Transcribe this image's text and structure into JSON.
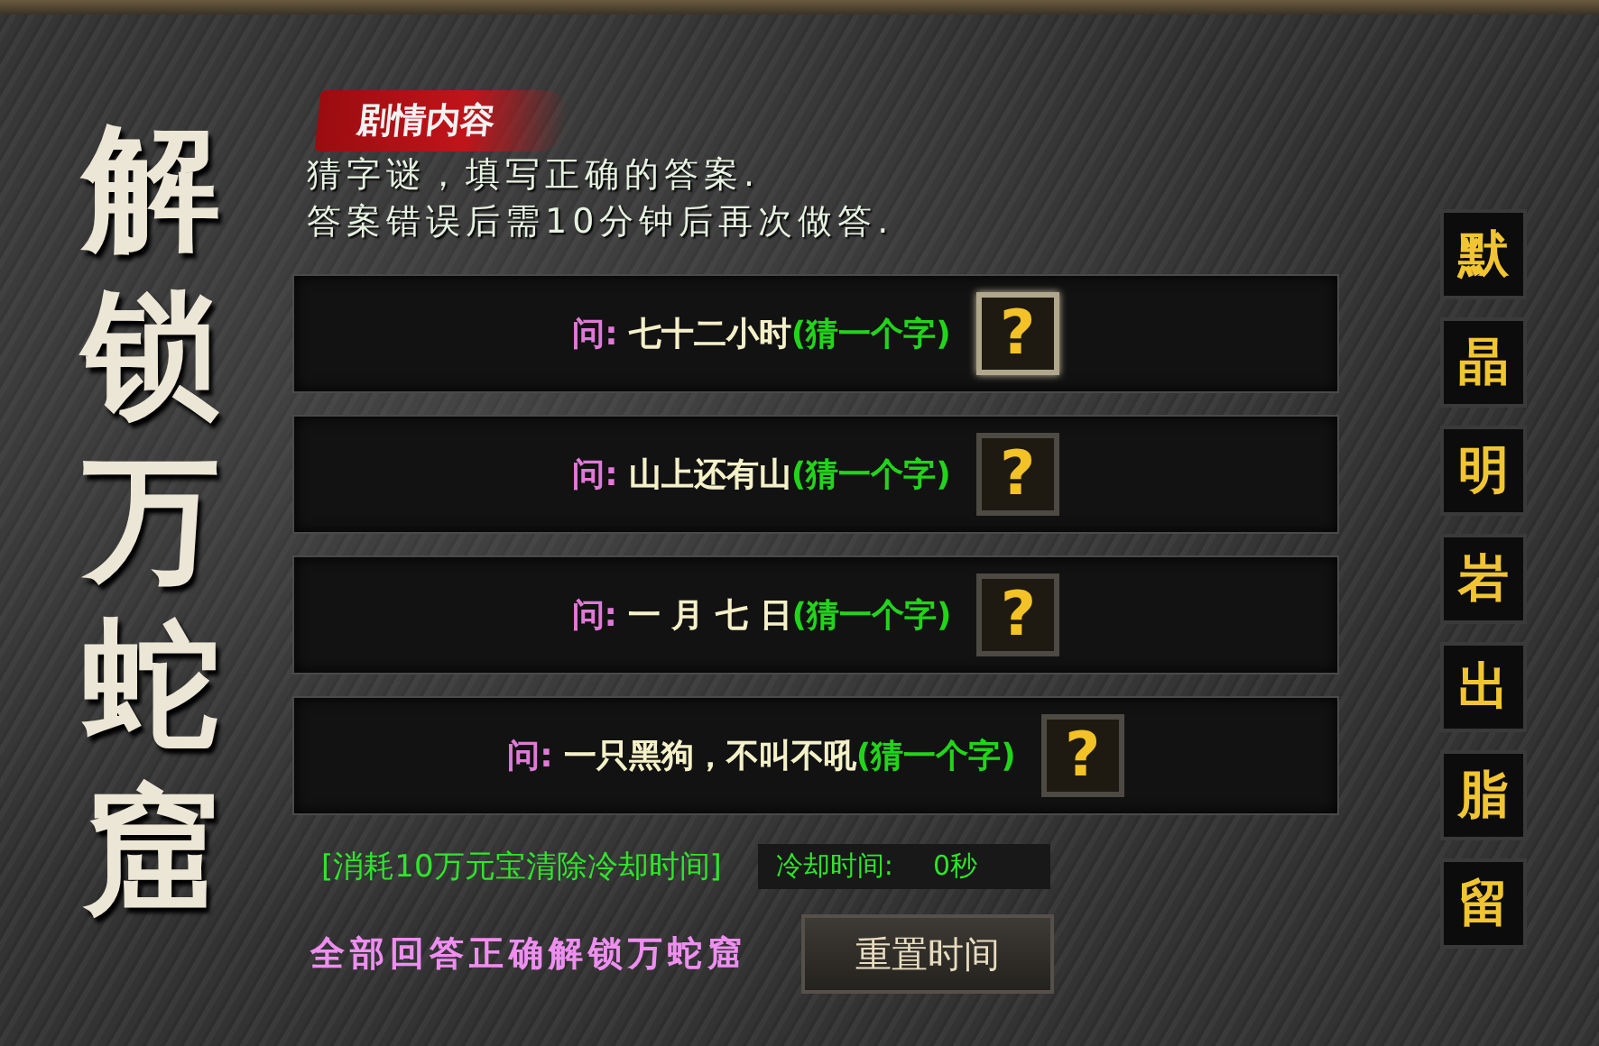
{
  "title": "解锁万蛇窟",
  "section_tab": {
    "label": "剧情内容"
  },
  "instructions": [
    "猜字谜，填写正确的答案.",
    "答案错误后需10分钟后再次做答."
  ],
  "questions": [
    {
      "label": "问:",
      "text": "七十二小时",
      "hint": "(猜一个字)",
      "button": "?",
      "selected": true
    },
    {
      "label": "问:",
      "text": "山上还有山",
      "hint": "(猜一个字)",
      "button": "?",
      "selected": false
    },
    {
      "label": "问:",
      "text": "一 月 七 日 ",
      "hint": "(猜一个字)",
      "button": "?",
      "selected": false
    },
    {
      "label": "问:",
      "text": "一只黑狗，不叫不吼",
      "hint": "(猜一个字)",
      "button": "?",
      "selected": false
    }
  ],
  "clear_cooldown_link": "[消耗10万元宝清除冷却时间]",
  "cooldown": {
    "label": "冷却时间:",
    "value": "0秒"
  },
  "goal": "全部回答正确解锁万蛇窟",
  "reset_button": "重置时间",
  "answer_tiles": [
    "默",
    "晶",
    "明",
    "岩",
    "出",
    "脂",
    "留"
  ]
}
